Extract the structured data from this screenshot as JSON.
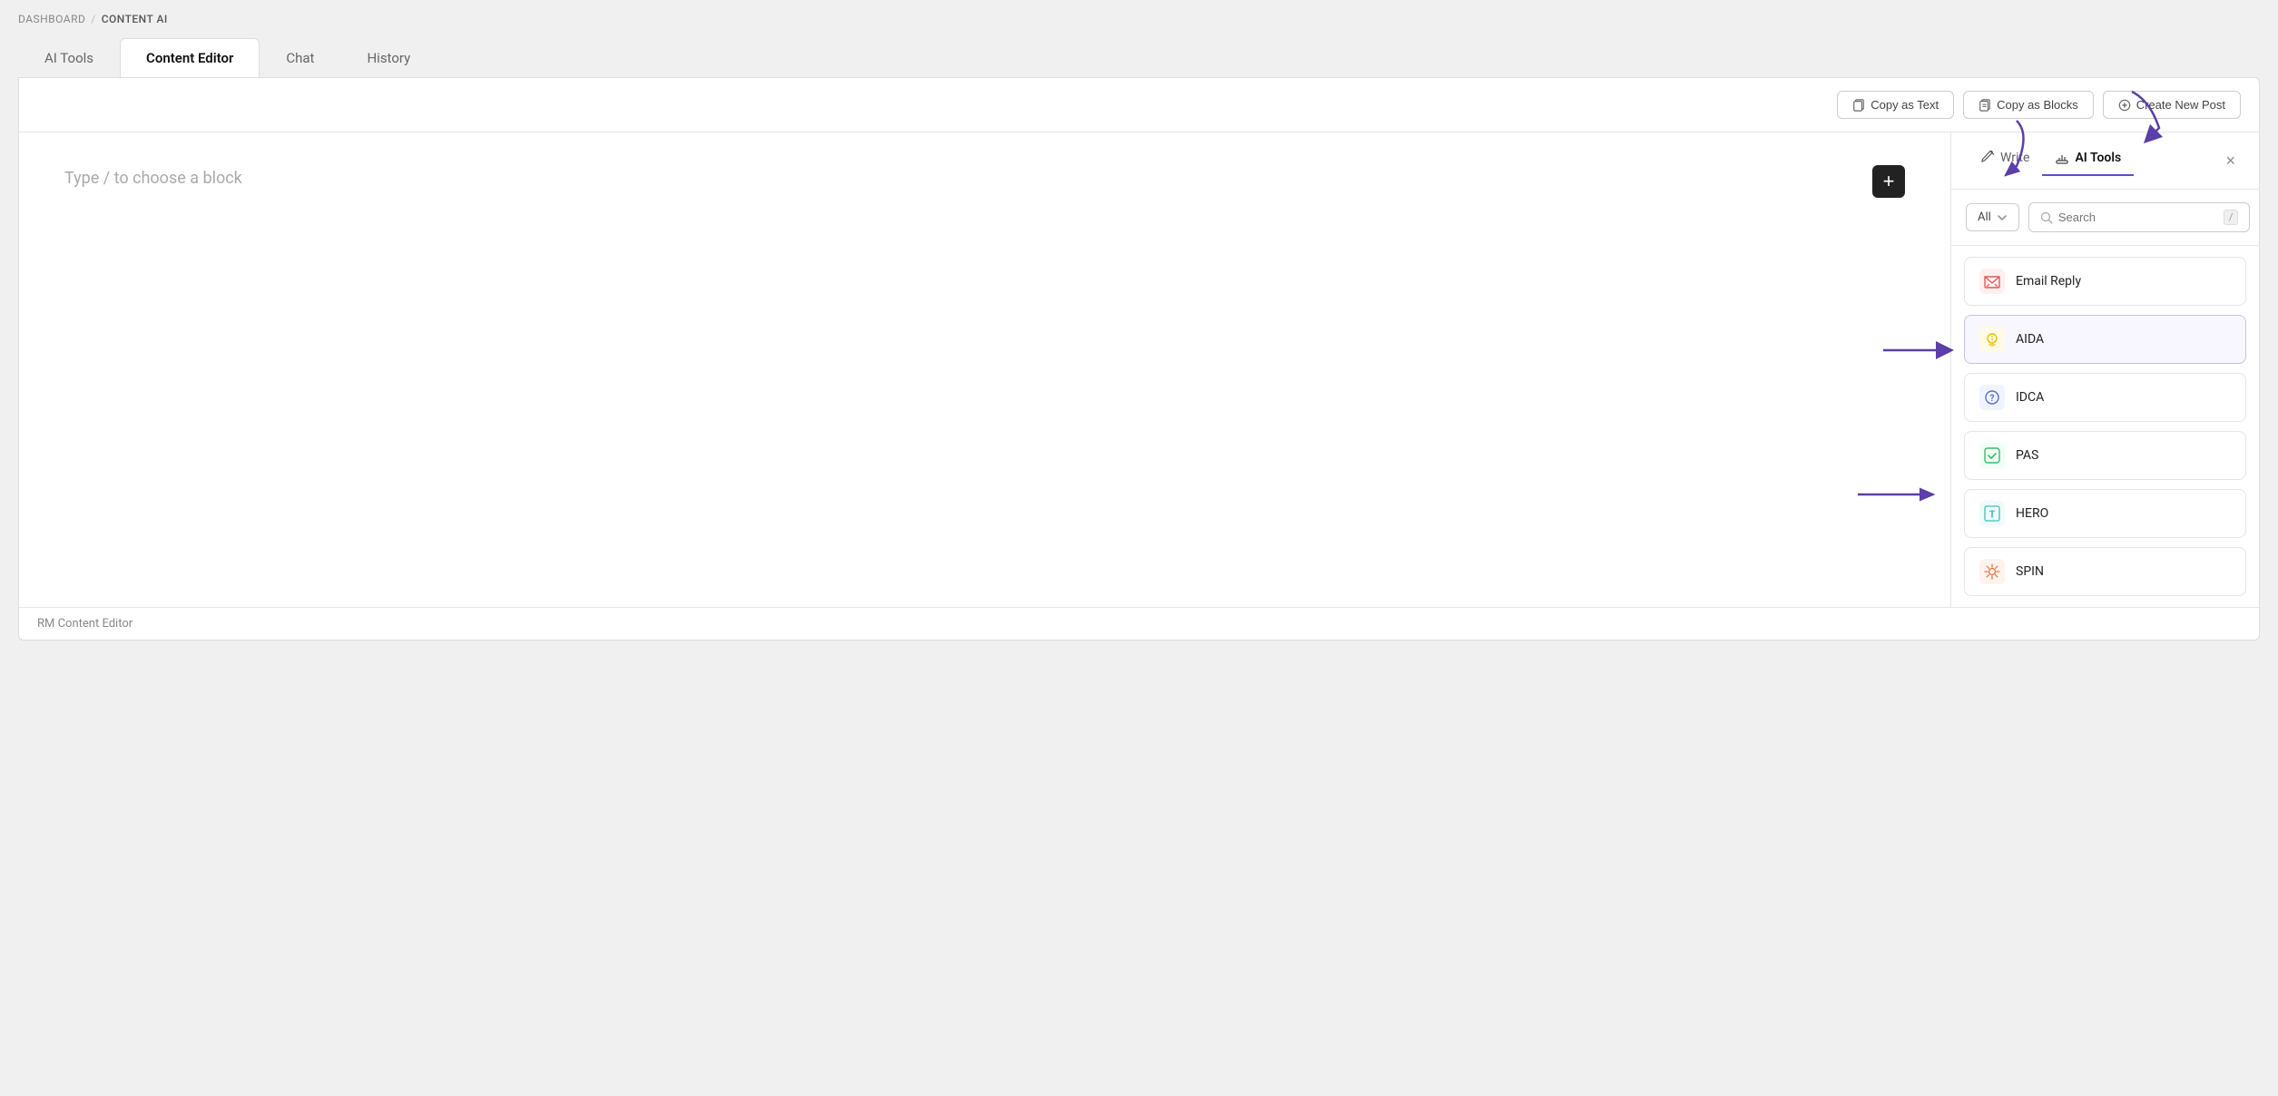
{
  "breadcrumb": {
    "home": "DASHBOARD",
    "separator": "/",
    "current": "CONTENT AI"
  },
  "tabs": [
    {
      "id": "ai-tools",
      "label": "AI Tools",
      "active": false
    },
    {
      "id": "content-editor",
      "label": "Content Editor",
      "active": true
    },
    {
      "id": "chat",
      "label": "Chat",
      "active": false
    },
    {
      "id": "history",
      "label": "History",
      "active": false
    }
  ],
  "toolbar": {
    "copy_text_label": "Copy as Text",
    "copy_blocks_label": "Copy as Blocks",
    "create_post_label": "Create New Post"
  },
  "editor": {
    "placeholder": "Type / to choose a block",
    "footer": "RM Content Editor"
  },
  "sidebar": {
    "write_tab": "Write",
    "ai_tools_tab": "AI Tools",
    "filter_all": "All",
    "search_placeholder": "Search",
    "search_shortcut": "/",
    "tools": [
      {
        "id": "email-reply",
        "label": "Email Reply",
        "icon": "email",
        "highlighted": false
      },
      {
        "id": "aida",
        "label": "AIDA",
        "icon": "bulb",
        "highlighted": true
      },
      {
        "id": "idca",
        "label": "IDCA",
        "icon": "question",
        "highlighted": false
      },
      {
        "id": "pas",
        "label": "PAS",
        "icon": "check",
        "highlighted": false
      },
      {
        "id": "hero",
        "label": "HERO",
        "icon": "type",
        "highlighted": false
      },
      {
        "id": "spin",
        "label": "SPIN",
        "icon": "spin",
        "highlighted": false
      }
    ]
  }
}
